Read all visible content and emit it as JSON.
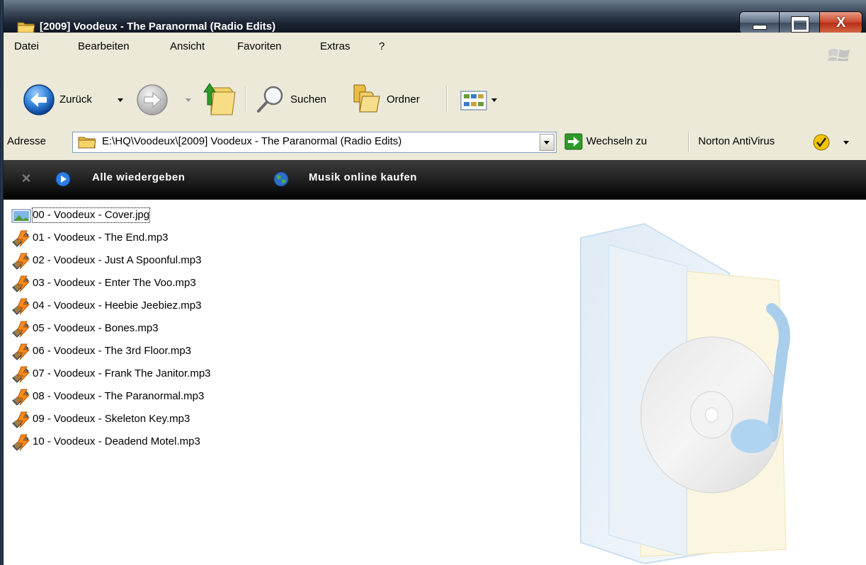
{
  "window": {
    "title": "[2009] Voodeux - The Paranormal (Radio Edits)",
    "close_glyph": "X"
  },
  "menu": {
    "items": [
      "Datei",
      "Bearbeiten",
      "Ansicht",
      "Favoriten",
      "Extras",
      "?"
    ]
  },
  "toolbar": {
    "back_label": "Zurück",
    "search_label": "Suchen",
    "folders_label": "Ordner"
  },
  "address": {
    "label": "Adresse",
    "path": "E:\\HQ\\Voodeux\\[2009] Voodeux - The Paranormal (Radio Edits)",
    "go_label": "Wechseln zu",
    "norton_label": "Norton AntiVirus"
  },
  "media_bar": {
    "close_glyph": "×",
    "play_all_label": "Alle wiedergeben",
    "buy_online_label": "Musik online kaufen"
  },
  "files": [
    {
      "name": "00 - Voodeux - Cover.jpg",
      "icon": "image-file-icon"
    },
    {
      "name": "01 - Voodeux - The End.mp3",
      "icon": "mp3-file-icon"
    },
    {
      "name": "02 - Voodeux - Just A Spoonful.mp3",
      "icon": "mp3-file-icon"
    },
    {
      "name": "03 - Voodeux - Enter The Voo.mp3",
      "icon": "mp3-file-icon"
    },
    {
      "name": "04 - Voodeux - Heebie Jeebiez.mp3",
      "icon": "mp3-file-icon"
    },
    {
      "name": "05 - Voodeux - Bones.mp3",
      "icon": "mp3-file-icon"
    },
    {
      "name": "06 - Voodeux - The 3rd Floor.mp3",
      "icon": "mp3-file-icon"
    },
    {
      "name": "07 - Voodeux - Frank The Janitor.mp3",
      "icon": "mp3-file-icon"
    },
    {
      "name": "08 - Voodeux - The Paranormal.mp3",
      "icon": "mp3-file-icon"
    },
    {
      "name": "09 - Voodeux - Skeleton Key.mp3",
      "icon": "mp3-file-icon"
    },
    {
      "name": "10 - Voodeux - Deadend Motel.mp3",
      "icon": "mp3-file-icon"
    }
  ],
  "colors": {
    "titlebar": "#1c2533",
    "toolbar_bg": "#ece9d8",
    "media_bar": "#111111",
    "close_button": "#c9452a",
    "address_border": "#7f9db9"
  }
}
